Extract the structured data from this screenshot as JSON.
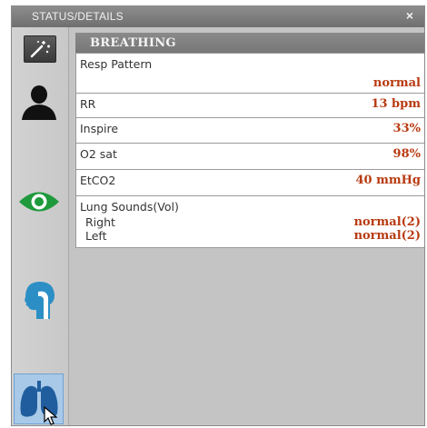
{
  "window": {
    "title": "STATUS/DETAILS",
    "close_label": "×"
  },
  "sidebar": {
    "items": [
      {
        "name": "wand",
        "icon": "magic-wand-icon",
        "active": false
      },
      {
        "name": "person",
        "icon": "person-icon",
        "active": false
      },
      {
        "name": "eye",
        "icon": "eye-icon",
        "active": false
      },
      {
        "name": "head-airway",
        "icon": "head-airway-icon",
        "active": false
      },
      {
        "name": "lungs",
        "icon": "lungs-icon",
        "active": true
      }
    ]
  },
  "panel": {
    "title": "BREATHING",
    "rows": [
      {
        "label": "Resp Pattern",
        "value": "normal"
      },
      {
        "label": "RR",
        "value": "13 bpm"
      },
      {
        "label": "Inspire",
        "value": "33%"
      },
      {
        "label": "O2 sat",
        "value": "98%"
      },
      {
        "label": "EtCO2",
        "value": "40 mmHg"
      }
    ],
    "lung_sounds": {
      "label": "Lung Sounds(Vol)",
      "right_label": "Right",
      "right_value": "normal(2)",
      "left_label": "Left",
      "left_value": "normal(2)"
    }
  },
  "colors": {
    "value_text": "#b83a10",
    "header_bg": "#7f7f7f",
    "panel_bg": "#c4c4c4",
    "eye_green": "#1e9a3c",
    "head_blue": "#2b8fc6",
    "lungs_blue": "#1f5d9e",
    "active_bg": "#a9c9e8"
  }
}
